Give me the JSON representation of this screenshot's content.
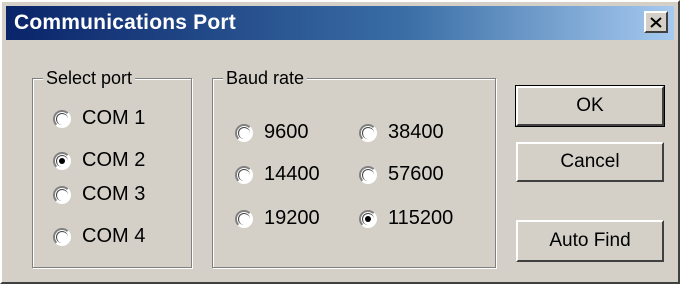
{
  "window": {
    "title": "Communications Port",
    "close_symbol": "×"
  },
  "select_port": {
    "label": "Select port",
    "options": [
      {
        "label": "COM 1",
        "checked": false
      },
      {
        "label": "COM 2",
        "checked": true
      },
      {
        "label": "COM 3",
        "checked": false
      },
      {
        "label": "COM 4",
        "checked": false
      }
    ]
  },
  "baud_rate": {
    "label": "Baud rate",
    "options": [
      {
        "label": "9600",
        "checked": false
      },
      {
        "label": "38400",
        "checked": false
      },
      {
        "label": "14400",
        "checked": false
      },
      {
        "label": "57600",
        "checked": false
      },
      {
        "label": "19200",
        "checked": false
      },
      {
        "label": "115200",
        "checked": true
      }
    ]
  },
  "buttons": {
    "ok": "OK",
    "cancel": "Cancel",
    "auto_find": "Auto Find"
  },
  "colors": {
    "face": "#d4d0c8",
    "title_start": "#0a246a",
    "title_end": "#a6caf0"
  }
}
